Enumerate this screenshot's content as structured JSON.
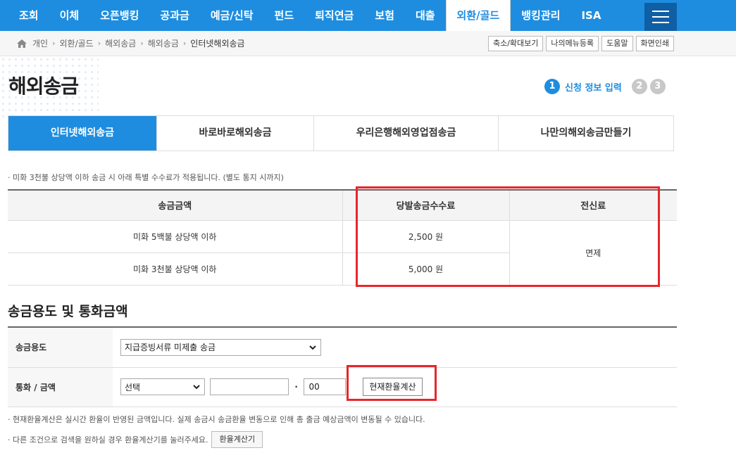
{
  "nav": {
    "items": [
      "조회",
      "이체",
      "오픈뱅킹",
      "공과금",
      "예금/신탁",
      "펀드",
      "퇴직연금",
      "보험",
      "대출",
      "외환/골드",
      "뱅킹관리",
      "ISA"
    ],
    "active_index": 9
  },
  "breadcrumb": [
    "개인",
    "외환/골드",
    "해외송금",
    "해외송금",
    "인터넷해외송금"
  ],
  "util_buttons": [
    "축소/확대보기",
    "나의메뉴등록",
    "도움말",
    "화면인쇄"
  ],
  "page_title": "해외송금",
  "steps": {
    "current": "1",
    "current_label": "신청 정보 입력",
    "others": [
      "2",
      "3"
    ]
  },
  "tabs": [
    "인터넷해외송금",
    "바로바로해외송금",
    "우리은행해외영업점송금",
    "나만의해외송금만들기"
  ],
  "fee_note": "미화 3천불 상당액 이하 송금 시 아래 특별 수수료가 적용됩니다. (별도 통지 시까지)",
  "fee_table": {
    "headers": [
      "송금금액",
      "당발송금수수료",
      "전신료"
    ],
    "rows": [
      {
        "amount": "미화 5백불 상당액 이하",
        "fee": "2,500 원"
      },
      {
        "amount": "미화 3천불 상당액 이하",
        "fee": "5,000 원"
      }
    ],
    "telegraph_fee": "면제"
  },
  "section_title": "송금용도 및 통화금액",
  "form": {
    "purpose_label": "송금용도",
    "purpose_value": "지급증빙서류 미제출 송금",
    "currency_label": "통화 / 금액",
    "currency_value": "선택",
    "amount_int": "",
    "amount_dot": "·",
    "amount_dec": "00",
    "calc_button": "현재환율계산"
  },
  "notes": {
    "realtime": "현재환율계산은 실시간 환율이 반영된 금액입니다. 실제 송금시 송금환율 변동으로 인해 총 출금 예상금액이 변동될 수 있습니다.",
    "other": "다른 조건으로 검색을 원하실 경우 환율계산기를 눌러주세요.",
    "calc_tool_button": "환율계산기"
  },
  "colors": {
    "brand": "#1e8de0",
    "highlight": "#e8262c"
  }
}
